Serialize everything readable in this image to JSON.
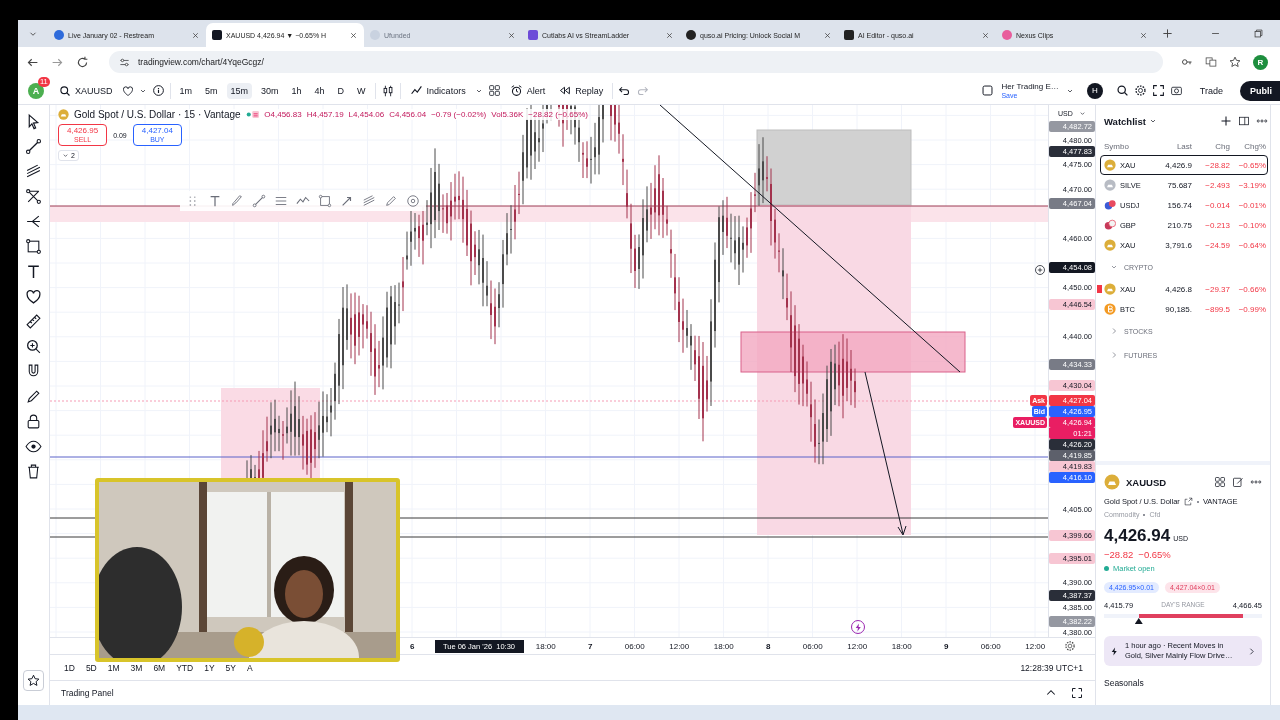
{
  "browser": {
    "tabs": [
      {
        "title": "Live January 02 - Restream",
        "selected": false,
        "dimmed": false
      },
      {
        "title": "XAUUSD 4,426.94 ▼ −0.65% H",
        "selected": true,
        "dimmed": false
      },
      {
        "title": "Ufunded",
        "selected": false,
        "dimmed": true
      },
      {
        "title": "Cutlabs AI vs StreamLadder",
        "selected": false,
        "dimmed": false
      },
      {
        "title": "quso.ai Pricing: Unlock Social M",
        "selected": false,
        "dimmed": false
      },
      {
        "title": "AI Editor - quso.ai",
        "selected": false,
        "dimmed": false
      },
      {
        "title": "Nexus Clips",
        "selected": false,
        "dimmed": false
      }
    ],
    "url": "tradingview.com/chart/4YqeGcgz/",
    "profile": "R"
  },
  "toolbar": {
    "avatar": "A",
    "notifications": "11",
    "symbol": "XAUUSD",
    "intervals": [
      {
        "label": "1m",
        "selected": false
      },
      {
        "label": "5m",
        "selected": false
      },
      {
        "label": "15m",
        "selected": true
      },
      {
        "label": "30m",
        "selected": false
      },
      {
        "label": "1h",
        "selected": false
      },
      {
        "label": "4h",
        "selected": false
      },
      {
        "label": "D",
        "selected": false
      },
      {
        "label": "W",
        "selected": false
      }
    ],
    "indicators": "Indicators",
    "alert": "Alert",
    "replay": "Replay",
    "layout": {
      "name": "Her Trading E…",
      "status": "Save"
    },
    "user": "H",
    "trade": "Trade",
    "publish": "Publi"
  },
  "chart": {
    "legend": {
      "title": "Gold Spot / U.S. Dollar · 15 · Vantage",
      "values": [
        "O4,456.83",
        "H4,457.19",
        "L4,454.06",
        "C4,456.04",
        "−0.79 (−0.02%)",
        "Vol5.36K",
        "−28.82 (−0.65%)"
      ],
      "sell": {
        "price": "4,426.95",
        "label": "SELL"
      },
      "spread": "0.09",
      "buy": {
        "price": "4,427.04",
        "label": "BUY"
      },
      "indicator_count": "2"
    },
    "price_axis": {
      "currency": "USD",
      "labels": [
        {
          "text": "4,482.72",
          "kind": "tag",
          "color": "#9598a1"
        },
        {
          "text": "4,480.00",
          "kind": "tick"
        },
        {
          "text": "4,477.83",
          "kind": "tag",
          "color": "#2a2e39"
        },
        {
          "text": "4,475.00",
          "kind": "tick"
        },
        {
          "text": "4,470.00",
          "kind": "tick"
        },
        {
          "text": "4,467.04",
          "kind": "tag",
          "color": "#787b86"
        },
        {
          "text": "4,460.00",
          "kind": "tick"
        },
        {
          "text": "4,454.08",
          "kind": "tag",
          "color": "#131722"
        },
        {
          "text": "4,450.00",
          "kind": "tick"
        },
        {
          "text": "4,446.54",
          "kind": "tag",
          "color": "#f7c6d3"
        },
        {
          "text": "4,440.00",
          "kind": "tick"
        },
        {
          "text": "4,434.33",
          "kind": "tag",
          "color": "#787b86"
        },
        {
          "text": "4,430.04",
          "kind": "tag",
          "color": "#f7c6d3"
        },
        {
          "text": "4,427.04",
          "kind": "tag",
          "color": "#f23645",
          "side_label": "Ask"
        },
        {
          "text": "4,426.95",
          "kind": "tag",
          "color": "#2962ff",
          "side_label": "Bid"
        },
        {
          "text": "4,426.94",
          "kind": "tag",
          "color": "#e91e63",
          "side_label": "XAUUSD",
          "countdown": "01:21"
        },
        {
          "text": "4,426.20",
          "kind": "tag",
          "color": "#2a2e39"
        },
        {
          "text": "4,419.85",
          "kind": "tag",
          "color": "#5d606b"
        },
        {
          "text": "4,419.83",
          "kind": "tag",
          "color": "#f7c6d3"
        },
        {
          "text": "4,416.10",
          "kind": "tag",
          "color": "#2962ff"
        },
        {
          "text": "4,405.00",
          "kind": "tick"
        },
        {
          "text": "4,399.66",
          "kind": "tag",
          "color": "#f7c6d3"
        },
        {
          "text": "4,395.01",
          "kind": "tag",
          "color": "#f7c6d3"
        },
        {
          "text": "4,390.00",
          "kind": "tick"
        },
        {
          "text": "4,387.37",
          "kind": "tag",
          "color": "#2a2e39"
        },
        {
          "text": "4,385.00",
          "kind": "tick"
        },
        {
          "text": "4,382.22",
          "kind": "tag",
          "color": "#9598a1"
        },
        {
          "text": "4,380.00",
          "kind": "tick"
        }
      ]
    },
    "time_axis": {
      "labels": [
        {
          "text": "6",
          "kind": "day"
        },
        {
          "text": "Tue 06 Jan '26  10:30",
          "kind": "crosshair"
        },
        {
          "text": "18:00",
          "kind": "tick"
        },
        {
          "text": "7",
          "kind": "day"
        },
        {
          "text": "06:00",
          "kind": "tick"
        },
        {
          "text": "12:00",
          "kind": "tick"
        },
        {
          "text": "18:00",
          "kind": "tick"
        },
        {
          "text": "8",
          "kind": "day"
        },
        {
          "text": "06:00",
          "kind": "tick"
        },
        {
          "text": "12:00",
          "kind": "tick"
        },
        {
          "text": "18:00",
          "kind": "tick"
        },
        {
          "text": "9",
          "kind": "day"
        },
        {
          "text": "06:00",
          "kind": "tick"
        },
        {
          "text": "12:00",
          "kind": "tick"
        }
      ]
    },
    "ranges": [
      "1D",
      "5D",
      "1M",
      "3M",
      "6M",
      "YTD",
      "1Y",
      "5Y",
      "A"
    ],
    "clock": "12:28:39 UTC+1"
  },
  "trading_panel": "Trading Panel",
  "watchlist": {
    "title": "Watchlist",
    "columns": [
      "Symbo",
      "Last",
      "Chg",
      "Chg%"
    ],
    "items": [
      {
        "kind": "symbol",
        "symbol": "XAU",
        "last": "4,426.9",
        "chg": "−28.82",
        "chg_pct": "−0.65%",
        "selected": true,
        "flagged": false
      },
      {
        "kind": "symbol",
        "symbol": "SILVE",
        "last": "75.687",
        "chg": "−2.493",
        "chg_pct": "−3.19%",
        "selected": false,
        "flagged": false
      },
      {
        "kind": "symbol",
        "symbol": "USDJ",
        "last": "156.74",
        "chg": "−0.014",
        "chg_pct": "−0.01%",
        "selected": false,
        "flagged": false
      },
      {
        "kind": "symbol",
        "symbol": "GBP",
        "last": "210.75",
        "chg": "−0.213",
        "chg_pct": "−0.10%",
        "selected": false,
        "flagged": false
      },
      {
        "kind": "symbol",
        "symbol": "XAU",
        "last": "3,791.6",
        "chg": "−24.59",
        "chg_pct": "−0.64%",
        "selected": false,
        "flagged": false
      },
      {
        "kind": "section",
        "label": "CRYPTO",
        "expanded": true,
        "children": [
          {
            "kind": "symbol",
            "symbol": "XAU",
            "last": "4,426.8",
            "chg": "−29.37",
            "chg_pct": "−0.66%",
            "selected": false,
            "flagged": true
          },
          {
            "kind": "symbol",
            "symbol": "BTC",
            "last": "90,185.",
            "chg": "−899.5",
            "chg_pct": "−0.99%",
            "selected": false,
            "flagged": false
          }
        ]
      },
      {
        "kind": "section",
        "label": "STOCKS",
        "expanded": false
      },
      {
        "kind": "section",
        "label": "FUTURES",
        "expanded": false
      }
    ]
  },
  "details": {
    "symbol": "XAUUSD",
    "name": "Gold Spot / U.S. Dollar",
    "exchange": "VANTAGE",
    "type": "Commodity",
    "subtype": "Cfd",
    "price": "4,426.94",
    "currency": "USD",
    "change": "−28.82",
    "change_pct": "−0.65%",
    "status": "Market open",
    "market_open": true,
    "bid": "4,426.95×0.01",
    "ask": "4,427.04×0.01",
    "range": {
      "low": "4,415.79",
      "label": "DAY'S RANGE",
      "high": "4,466.45",
      "level": 0.22
    },
    "news": "1 hour ago · Recent Moves in Gold, Silver Mainly Flow Drive…",
    "seasonals": "Seasonals"
  }
}
